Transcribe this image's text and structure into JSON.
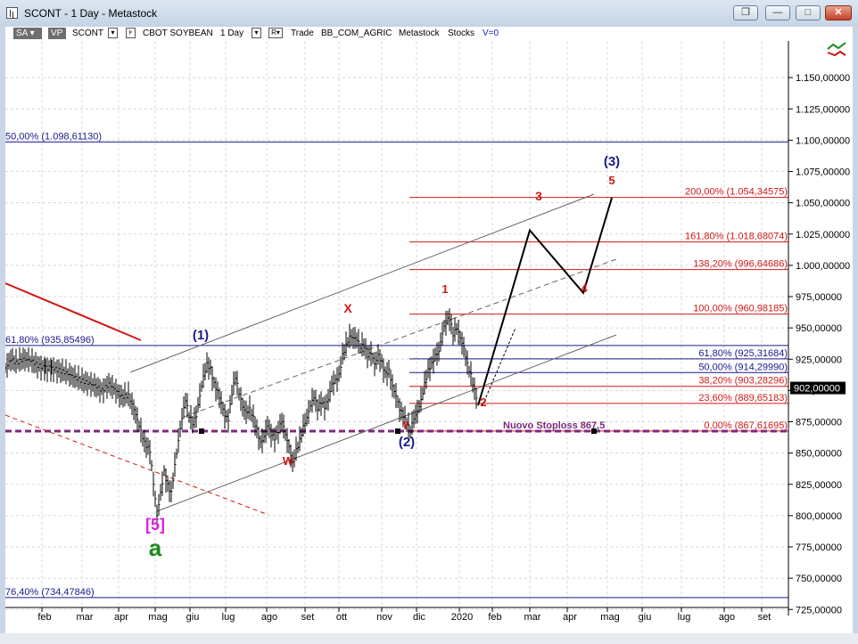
{
  "window": {
    "title": "SCONT - 1 Day - Metastock",
    "buttons": [
      "minimize",
      "maximize",
      "close"
    ]
  },
  "toolbar": {
    "sa_label": "SA",
    "vp_label": "VP",
    "symbol": "SCONT",
    "name": "CBOT SOYBEAN",
    "period": "1 Day",
    "r_label": "R",
    "trade": "Trade",
    "sector": "BB_COM_AGRIC",
    "source": "Metastock",
    "stocks": "Stocks",
    "volume": "V=0"
  },
  "colors": {
    "red": "#d01818",
    "blue": "#1a1a8c",
    "purple": "#7b2a7b",
    "magenta": "#e020e0",
    "green": "#1a8a1a",
    "grid": "#d8d8d8"
  },
  "chart_data": {
    "type": "candlestick",
    "last_price": "902,00000",
    "x_axis": {
      "tick_labels": [
        "feb",
        "mar",
        "apr",
        "mag",
        "giu",
        "lug",
        "ago",
        "set",
        "ott",
        "nov",
        "dic",
        "2020",
        "feb",
        "mar",
        "apr",
        "mag",
        "giu",
        "lug",
        "ago",
        "set"
      ]
    },
    "y_axis": {
      "range": [
        700,
        1175
      ],
      "ticks": [
        725,
        750,
        775,
        800,
        825,
        850,
        875,
        900,
        925,
        950,
        975,
        1000,
        1025,
        1050,
        1075,
        1100,
        1125,
        1150
      ],
      "tick_labels": [
        "725,00000",
        "750,00000",
        "775,00000",
        "800,00000",
        "825,00000",
        "850,00000",
        "875,00000",
        "900,00000",
        "925,00000",
        "950,00000",
        "975,00000",
        "1.000,00000",
        "1.025,00000",
        "1.050,00000",
        "1.075,00000",
        "1.100,00000",
        "1.125,00000",
        "1.150,00000"
      ]
    },
    "price_path": [
      [
        0,
        918
      ],
      [
        6,
        925
      ],
      [
        12,
        922
      ],
      [
        20,
        925
      ],
      [
        28,
        924
      ],
      [
        36,
        920
      ],
      [
        45,
        918
      ],
      [
        52,
        918
      ],
      [
        60,
        916
      ],
      [
        68,
        914
      ],
      [
        76,
        911
      ],
      [
        84,
        908
      ],
      [
        92,
        906
      ],
      [
        100,
        904
      ],
      [
        108,
        900
      ],
      [
        116,
        905
      ],
      [
        124,
        900
      ],
      [
        130,
        895
      ],
      [
        138,
        896
      ],
      [
        144,
        885
      ],
      [
        150,
        872
      ],
      [
        156,
        858
      ],
      [
        162,
        852
      ],
      [
        166,
        826
      ],
      [
        170,
        800
      ],
      [
        174,
        818
      ],
      [
        178,
        835
      ],
      [
        182,
        824
      ],
      [
        186,
        818
      ],
      [
        190,
        840
      ],
      [
        194,
        860
      ],
      [
        198,
        878
      ],
      [
        202,
        893
      ],
      [
        206,
        880
      ],
      [
        210,
        874
      ],
      [
        214,
        880
      ],
      [
        218,
        896
      ],
      [
        222,
        911
      ],
      [
        226,
        921
      ],
      [
        230,
        917
      ],
      [
        234,
        905
      ],
      [
        238,
        899
      ],
      [
        242,
        890
      ],
      [
        246,
        880
      ],
      [
        250,
        877
      ],
      [
        254,
        898
      ],
      [
        258,
        911
      ],
      [
        262,
        898
      ],
      [
        266,
        887
      ],
      [
        270,
        882
      ],
      [
        274,
        885
      ],
      [
        278,
        878
      ],
      [
        282,
        868
      ],
      [
        286,
        858
      ],
      [
        290,
        863
      ],
      [
        294,
        872
      ],
      [
        298,
        865
      ],
      [
        302,
        862
      ],
      [
        306,
        868
      ],
      [
        310,
        876
      ],
      [
        314,
        865
      ],
      [
        318,
        855
      ],
      [
        322,
        842
      ],
      [
        326,
        852
      ],
      [
        330,
        860
      ],
      [
        334,
        871
      ],
      [
        338,
        878
      ],
      [
        342,
        888
      ],
      [
        346,
        895
      ],
      [
        350,
        886
      ],
      [
        354,
        891
      ],
      [
        358,
        887
      ],
      [
        362,
        893
      ],
      [
        366,
        905
      ],
      [
        370,
        908
      ],
      [
        374,
        912
      ],
      [
        378,
        928
      ],
      [
        382,
        936
      ],
      [
        386,
        943
      ],
      [
        390,
        942
      ],
      [
        394,
        941
      ],
      [
        398,
        935
      ],
      [
        402,
        936
      ],
      [
        406,
        928
      ],
      [
        410,
        930
      ],
      [
        414,
        921
      ],
      [
        418,
        928
      ],
      [
        422,
        922
      ],
      [
        426,
        913
      ],
      [
        430,
        916
      ],
      [
        434,
        903
      ],
      [
        438,
        896
      ],
      [
        442,
        885
      ],
      [
        446,
        880
      ],
      [
        450,
        874
      ],
      [
        454,
        868
      ],
      [
        458,
        878
      ],
      [
        462,
        883
      ],
      [
        466,
        892
      ],
      [
        470,
        905
      ],
      [
        474,
        916
      ],
      [
        478,
        921
      ],
      [
        482,
        928
      ],
      [
        486,
        931
      ],
      [
        490,
        946
      ],
      [
        494,
        955
      ],
      [
        498,
        958
      ],
      [
        502,
        945
      ],
      [
        506,
        950
      ],
      [
        510,
        942
      ],
      [
        514,
        934
      ],
      [
        518,
        921
      ],
      [
        522,
        912
      ],
      [
        526,
        900
      ],
      [
        530,
        890
      ]
    ],
    "horizontal_lines": [
      {
        "label": "50,00% (1.098,61130)",
        "value": 1098.6,
        "color": "#1a1a8c",
        "side": "left"
      },
      {
        "label": "61,80% (935,85496)",
        "value": 935.9,
        "color": "#1a1a8c",
        "side": "left"
      },
      {
        "label": "76,40% (734,47846)",
        "value": 734.5,
        "color": "#1a1a8c",
        "side": "left"
      },
      {
        "label": "200,00% (1.054,34575)",
        "value": 1054.3,
        "color": "#d01818",
        "side": "right"
      },
      {
        "label": "161,80% (1.018,68074)",
        "value": 1018.7,
        "color": "#d01818",
        "side": "right"
      },
      {
        "label": "138,20% (996,64686)",
        "value": 996.6,
        "color": "#d01818",
        "side": "right"
      },
      {
        "label": "100,00% (960,98185)",
        "value": 961.0,
        "color": "#d01818",
        "side": "right"
      },
      {
        "label": "61,80% (925,31684)",
        "value": 925.3,
        "color": "#1a1a8c",
        "side": "right"
      },
      {
        "label": "50,00% (914,29990)",
        "value": 914.3,
        "color": "#1a1a8c",
        "side": "right"
      },
      {
        "label": "38,20% (903,28296)",
        "value": 903.3,
        "color": "#d01818",
        "side": "right"
      },
      {
        "label": "23,60% (889,65183)",
        "value": 889.7,
        "color": "#d01818",
        "side": "right"
      },
      {
        "label": "0,00% (867,61695)",
        "value": 867.6,
        "color": "#d01818",
        "side": "right"
      }
    ],
    "stoploss": {
      "label": "Nuovo Stoploss 867,5",
      "value": 867.5,
      "color": "#7b2a7b"
    },
    "wave_labels": [
      {
        "text": "(3)",
        "color": "#1a1a8c"
      },
      {
        "text": "5",
        "color": "#d01818"
      },
      {
        "text": "3",
        "color": "#d01818"
      },
      {
        "text": "4",
        "color": "#d01818"
      },
      {
        "text": "1",
        "color": "#d01818"
      },
      {
        "text": "2",
        "color": "#d01818"
      },
      {
        "text": "X",
        "color": "#d01818"
      },
      {
        "text": "(1)",
        "color": "#1a1a8c"
      },
      {
        "text": "Y",
        "color": "#d01818"
      },
      {
        "text": "(2)",
        "color": "#1a1a8c"
      },
      {
        "text": "W",
        "color": "#d01818"
      },
      {
        "text": "[5]",
        "color": "#e020e0"
      },
      {
        "text": "a",
        "color": "#1a8a1a"
      }
    ]
  }
}
